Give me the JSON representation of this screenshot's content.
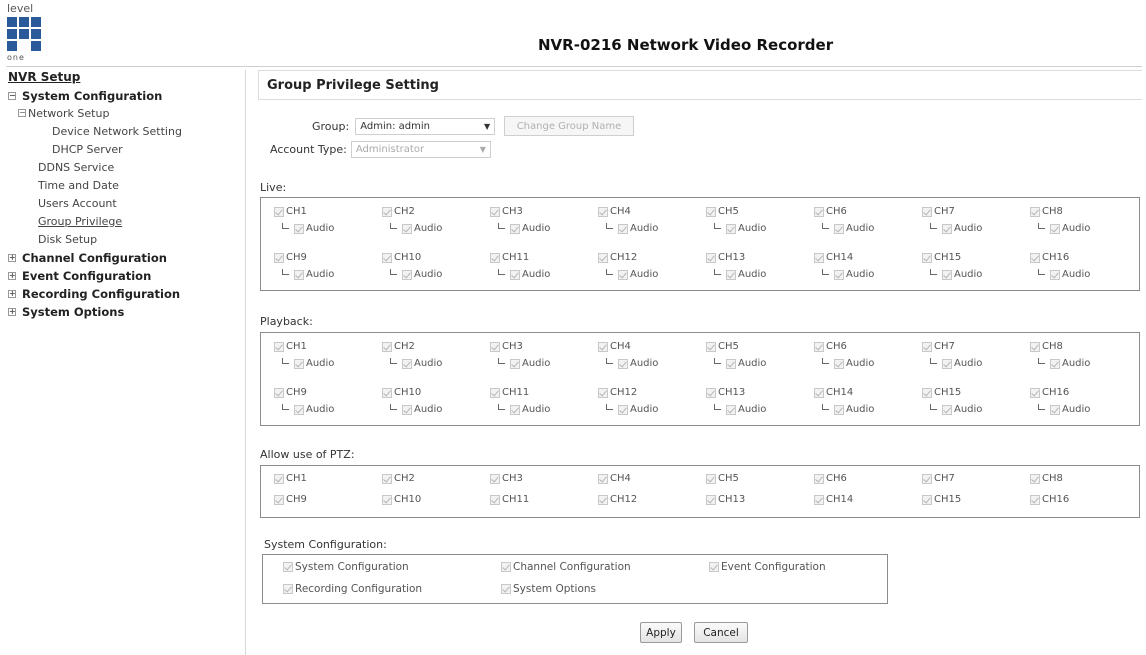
{
  "logo": {
    "top": "level",
    "bottom": "one"
  },
  "app_title": "NVR-0216 Network Video Recorder",
  "sidebar": {
    "heading": "NVR Setup",
    "system_configuration": "System Configuration",
    "network_setup": "Network Setup",
    "device_network_setting": "Device Network Setting",
    "dhcp_server": "DHCP Server",
    "ddns_service": "DDNS Service",
    "time_and_date": "Time and Date",
    "users_account": "Users Account",
    "group_privilege": "Group Privilege",
    "disk_setup": "Disk Setup",
    "channel_configuration": "Channel Configuration",
    "event_configuration": "Event Configuration",
    "recording_configuration": "Recording Configuration",
    "system_options": "System Options"
  },
  "main": {
    "title": "Group Privilege Setting",
    "group_label": "Group:",
    "group_value": "Admin: admin",
    "change_group_name": "Change Group Name",
    "account_type_label": "Account Type:",
    "account_type_value": "Administrator",
    "live_label": "Live:",
    "playback_label": "Playback:",
    "ptz_label": "Allow use of PTZ:",
    "syscfg_label": "System Configuration:",
    "audio_label": "Audio",
    "channels": [
      "CH1",
      "CH2",
      "CH3",
      "CH4",
      "CH5",
      "CH6",
      "CH7",
      "CH8",
      "CH9",
      "CH10",
      "CH11",
      "CH12",
      "CH13",
      "CH14",
      "CH15",
      "CH16"
    ],
    "system_items": [
      "System Configuration",
      "Channel Configuration",
      "Event Configuration",
      "Recording Configuration",
      "System Options"
    ],
    "apply": "Apply",
    "cancel": "Cancel"
  },
  "colors": {
    "logo_blue": "#2a5a9a",
    "border": "#8c8c8c"
  }
}
